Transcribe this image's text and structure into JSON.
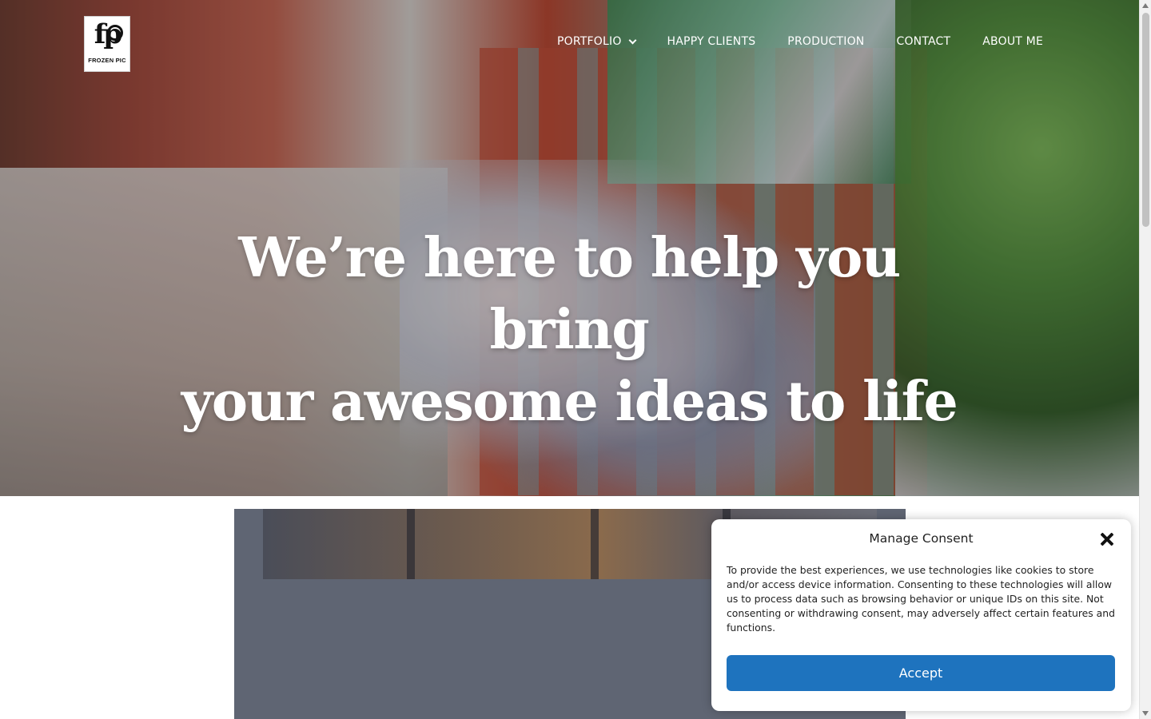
{
  "brand": {
    "logo_text": "FROZEN PIC",
    "logo_mark": "fp"
  },
  "nav": {
    "items": [
      {
        "label": "PORTFOLIO",
        "has_dropdown": true
      },
      {
        "label": "HAPPY CLIENTS"
      },
      {
        "label": "PRODUCTION"
      },
      {
        "label": "CONTACT"
      },
      {
        "label": "ABOUT ME"
      }
    ]
  },
  "hero": {
    "headline_line1": "We’re here to help you bring",
    "headline_line2": "your awesome ideas to life"
  },
  "consent": {
    "title": "Manage Consent",
    "body": "To provide the best experiences, we use technologies like cookies to store and/or access device information. Consenting to these technologies will allow us to process data such as browsing behavior or unique IDs on this site. Not consenting or withdrawing consent, may adversely affect certain features and functions.",
    "accept_label": "Accept",
    "accent_color": "#1e73be"
  },
  "icons": {
    "dropdown": "chevron-down-icon",
    "close": "close-icon"
  }
}
